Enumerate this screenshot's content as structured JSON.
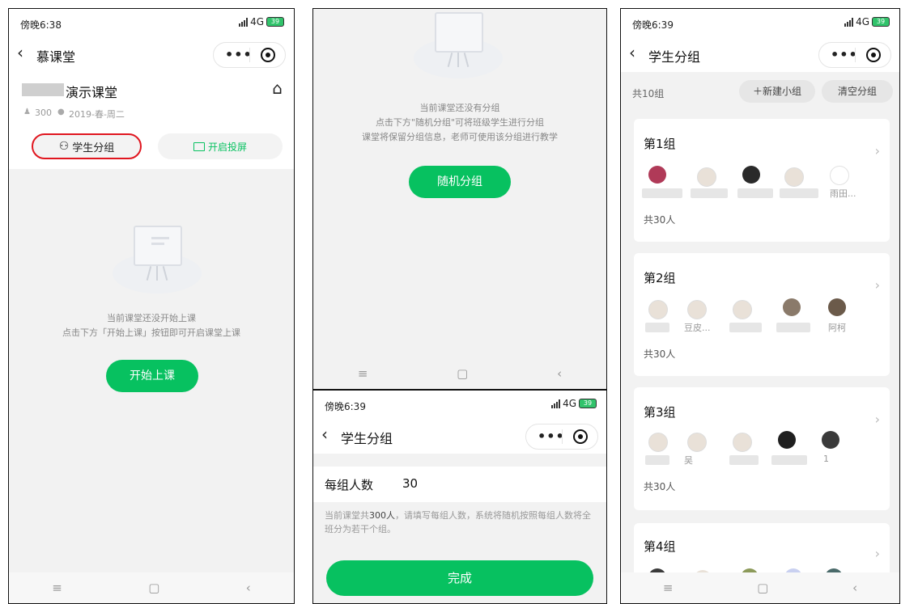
{
  "status": {
    "time1": "傍晚6:38",
    "time2": "傍晚6:39",
    "time3": "傍晚6:39",
    "signal": "4G",
    "battery": "39"
  },
  "panel1": {
    "nav_title": "慕课堂",
    "class_name": "演示课堂",
    "student_count": "300",
    "term": "2019-春-周二",
    "group_button": "学生分组",
    "projection_button": "开启投屏",
    "empty_line1": "当前课堂还没开始上课",
    "empty_line2": "点击下方「开始上课」按钮即可开启课堂上课",
    "start_button": "开始上课"
  },
  "panel2": {
    "empty_line1": "当前课堂还没有分组",
    "empty_line2": "点击下方\"随机分组\"可将班级学生进行分组",
    "empty_line3": "课堂将保留分组信息，老师可使用该分组进行教学",
    "random_button": "随机分组"
  },
  "panel3": {
    "nav_title": "学生分组",
    "field_label": "每组人数",
    "field_value": "30",
    "desc_part1": "当前课堂共",
    "desc_count": "300人",
    "desc_part2": "，请填写每组人数，系统将随机按照每组人数将全班分为若干个组。",
    "done_button": "完成"
  },
  "panel4": {
    "nav_title": "学生分组",
    "total": "共10组",
    "new_group_button": "＋新建小组",
    "clear_button": "清空分组",
    "groups": [
      {
        "title": "第1组",
        "count": "共30人",
        "names": [
          "",
          "",
          "",
          "",
          "雨田..."
        ]
      },
      {
        "title": "第2组",
        "count": "共30人",
        "names": [
          "",
          "豆皮...",
          "",
          "",
          "阿柯"
        ]
      },
      {
        "title": "第3组",
        "count": "共30人",
        "names": [
          "",
          "吴",
          "",
          "",
          "1"
        ]
      },
      {
        "title": "第4组",
        "count": "",
        "names": []
      }
    ]
  },
  "softkeys": {
    "menu": "≡",
    "home": "▢",
    "back": "‹"
  },
  "icons": {
    "back": "‹",
    "home": "⌂",
    "group": "☺",
    "screen": "▭",
    "chevron": "›"
  },
  "colors": {
    "accent": "#07c160",
    "highlight": "#e0161f"
  }
}
